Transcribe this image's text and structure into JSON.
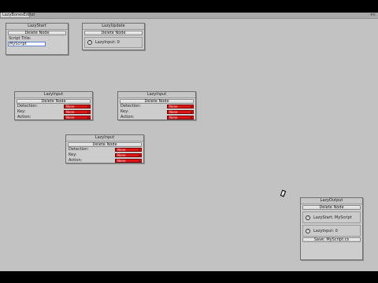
{
  "window": {
    "tab_title": "LazyBonesEditor"
  },
  "nodes": {
    "lazy_start": {
      "title": "LazyStart",
      "delete_label": "Delete Node",
      "script_title_label": "Script Title:",
      "script_title_value": "MyScript"
    },
    "lazy_update": {
      "title": "LazyUpdate",
      "delete_label": "Delete Node",
      "info_text": "LazyInput: 0"
    },
    "lazy_input_1": {
      "title": "LazyInput",
      "delete_label": "Delete Node",
      "detection_label": "Detection:",
      "key_label": "Key:",
      "action_label": "Action:",
      "detection_value": "None",
      "key_value": "None",
      "action_value": "None"
    },
    "lazy_input_2": {
      "title": "LazyInput",
      "delete_label": "Delete Node",
      "detection_label": "Detection:",
      "key_label": "Key:",
      "action_label": "Action:",
      "detection_value": "None",
      "key_value": "None",
      "action_value": "None"
    },
    "lazy_input_3": {
      "title": "LazyInput",
      "delete_label": "Delete Node",
      "detection_label": "Detection:",
      "key_label": "Key:",
      "action_label": "Action:",
      "detection_value": "None",
      "key_value": "None",
      "action_value": "None"
    },
    "lazy_output": {
      "title": "LazyOutput",
      "delete_label": "Delete Node",
      "info_start": "LazyStart: MyScript",
      "info_input": "LazyInput: 0",
      "save_label": "Save: MyScript.cs"
    }
  },
  "colors": {
    "dropdown_red": "#dd1616",
    "canvas_gray": "#c2c2c2"
  }
}
